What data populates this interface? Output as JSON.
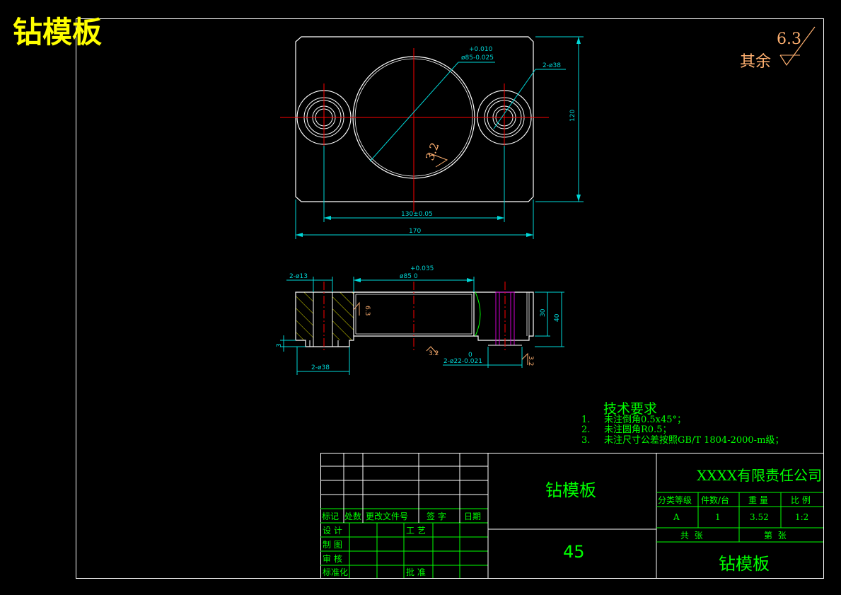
{
  "sheet_title": "钻模板",
  "roughness": {
    "other_label": "其余",
    "other_value": "6.3",
    "bore_value": "3.2",
    "side_value": "6.3",
    "bottom_value": "3.2",
    "pin_value": "3.2"
  },
  "dims_top": {
    "bore_upper": "+0.010",
    "bore_main": "ø85-0.025",
    "holes": "2-ø38",
    "height": "120",
    "center_dist": "130±0.05",
    "width": "170"
  },
  "dims_section": {
    "hole_small": "2-ø13",
    "bore_upper": "+0.035",
    "bore_main": "ø85 0",
    "depth_30": "30",
    "height_40": "40",
    "step": "3",
    "counterbore": "2-ø38",
    "pin_upper": "0",
    "pin_main": "2-ø22-0.021"
  },
  "tech_req": {
    "title": "技术要求",
    "items": [
      {
        "num": "1.",
        "text": "未注倒角0.5x45°；"
      },
      {
        "num": "2.",
        "text": "未注圆角R0.5；"
      },
      {
        "num": "3.",
        "text": "未注尺寸公差按照GB/T 1804-2000-m级；"
      }
    ]
  },
  "title_block": {
    "rev_headers": [
      "标记",
      "处数",
      "更改文件号",
      "签 字",
      "日期"
    ],
    "sign_rows": [
      {
        "label": "设 计",
        "label2": "工 艺"
      },
      {
        "label": "制 图"
      },
      {
        "label": "审 核"
      },
      {
        "label": "标准化",
        "label2": "批 准"
      }
    ],
    "part_name": "钻模板",
    "material": "45",
    "company": "XXXX有限责任公司",
    "info_headers": [
      "分类等级",
      "件数/台",
      "重 量",
      "比 例"
    ],
    "info_values": [
      "A",
      "1",
      "3.52",
      "1:2"
    ],
    "sheet_total": "共  张",
    "sheet_no": "第  张",
    "drawing_name": "钻模板"
  },
  "colors": {
    "background": "#000000",
    "frame": "#ffffff",
    "text_green": "#00ff00",
    "dimension_cyan": "#00d8d8",
    "centerline_red": "#ff0000",
    "hatch_yellow": "#d8d800",
    "roughness_orange": "#ffb070",
    "title_yellow": "#ffff00",
    "pin_magenta": "#d000d0"
  }
}
